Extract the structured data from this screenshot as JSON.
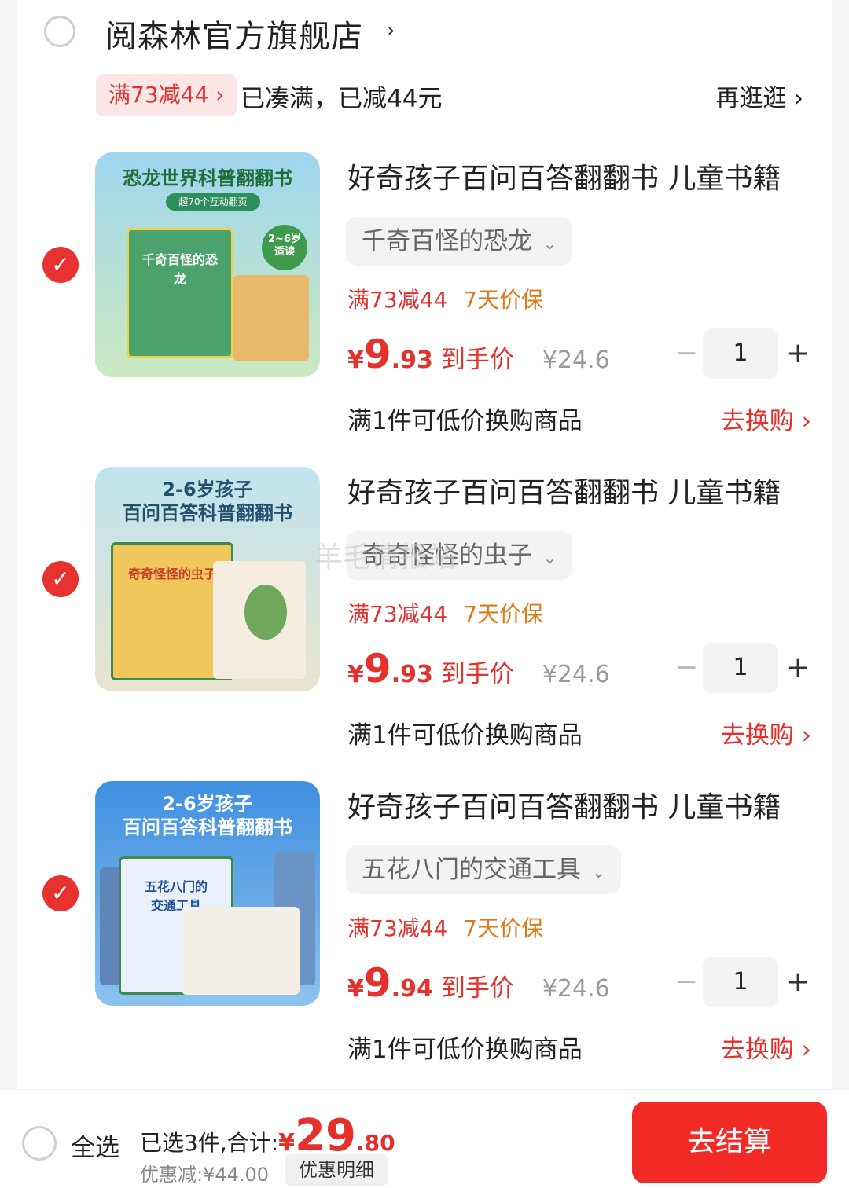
{
  "store": {
    "name": "阅森林官方旗舰店",
    "chevron": "›"
  },
  "promo_banner": {
    "tag": "满73减44 ›",
    "status": "已凑满，已减44元",
    "browse_more": "再逛逛 ›"
  },
  "items": [
    {
      "cover_title": "恐龙世界科普翻翻书",
      "cover_subtitle": "超70个互动翻页",
      "cover_badge": "2~6岁\n适读",
      "cover_book_title": "千奇百怪的恐龙",
      "title": "好奇孩子百问百答翻翻书 儿童书籍",
      "variant": "千奇百怪的恐龙",
      "promo1": "满73减44",
      "promo2": "7天价保",
      "yen": "¥",
      "price_int": "9",
      "price_dec": ".93",
      "final_label": "到手价",
      "orig_price": "¥24.6",
      "qty": "1",
      "swap_text": "满1件可低价换购商品",
      "swap_link": "去换购 ›"
    },
    {
      "cover_title": "2-6岁孩子\n百问百答科普翻翻书",
      "cover_book_title": "奇奇怪怪的虫子",
      "title": "好奇孩子百问百答翻翻书 儿童书籍",
      "variant": "奇奇怪怪的虫子",
      "promo1": "满73减44",
      "promo2": "7天价保",
      "yen": "¥",
      "price_int": "9",
      "price_dec": ".93",
      "final_label": "到手价",
      "orig_price": "¥24.6",
      "qty": "1",
      "swap_text": "满1件可低价换购商品",
      "swap_link": "去换购 ›"
    },
    {
      "cover_title": "2-6岁孩子\n百问百答科普翻翻书",
      "cover_book_title": "五花八门的\n交通工具",
      "title": "好奇孩子百问百答翻翻书 儿童书籍",
      "variant": "五花八门的交通工具",
      "promo1": "满73减44",
      "promo2": "7天价保",
      "yen": "¥",
      "price_int": "9",
      "price_dec": ".94",
      "final_label": "到手价",
      "orig_price": "¥24.6",
      "qty": "1",
      "swap_text": "满1件可低价换购商品",
      "swap_link": "去换购 ›"
    }
  ],
  "watermark": "羊毛情报站",
  "bottom": {
    "select_all": "全选",
    "summary_prefix": "已选3件,合计:",
    "yen": "¥",
    "total_int": "29",
    "total_dec": ".80",
    "discount": "优惠减:¥44.00",
    "discount_detail": "优惠明细",
    "checkout": "去结算"
  },
  "colors": {
    "accent": "#e5302c",
    "price_protect": "#e07a18",
    "checkout_bg": "#f22a25"
  }
}
